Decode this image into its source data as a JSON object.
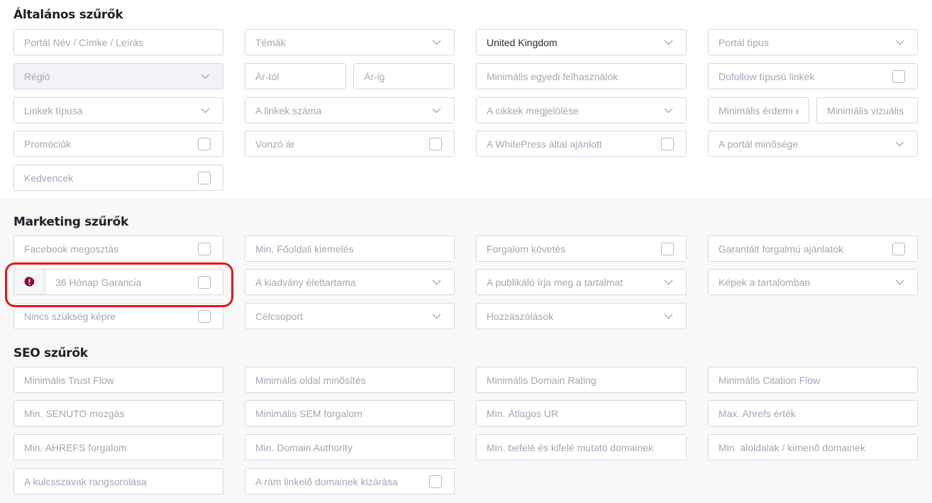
{
  "sections": {
    "general": {
      "title": "Általános szűrők",
      "fields": {
        "portal_search": {
          "placeholder": "Portál Név / Címke / Leírás",
          "type": "text"
        },
        "topics": {
          "label": "Témák",
          "type": "select"
        },
        "country": {
          "value": "United Kingdom",
          "type": "select"
        },
        "portal_type": {
          "label": "Portál típus",
          "type": "select"
        },
        "region": {
          "label": "Régió",
          "type": "select",
          "disabled": true
        },
        "price_from": {
          "placeholder": "Ár-tól",
          "type": "text"
        },
        "price_to": {
          "placeholder": "Ár-ig",
          "type": "text"
        },
        "min_unique_users": {
          "placeholder": "Minimális egyedi felhasználók",
          "type": "text"
        },
        "dofollow_links": {
          "label": "Dofollow típusú linkek",
          "type": "checkbox",
          "checked": false
        },
        "link_type": {
          "label": "Linkek típusa",
          "type": "select"
        },
        "link_count": {
          "label": "A linkek száma",
          "type": "select"
        },
        "article_marking": {
          "label": "A cikkek megjelölése",
          "type": "select"
        },
        "min_substantive": {
          "placeholder": "Minimális érdemi é",
          "type": "text"
        },
        "min_visual": {
          "placeholder": "Minimális vizuális é",
          "type": "text"
        },
        "promotions": {
          "label": "Promóciók",
          "type": "checkbox",
          "checked": false
        },
        "attractive_price": {
          "label": "Vonzó ár",
          "type": "checkbox",
          "checked": false
        },
        "whitepress_recommended": {
          "label": "A WhitePress által ajánlott",
          "type": "checkbox",
          "checked": false
        },
        "portal_quality": {
          "label": "A portál minősége",
          "type": "select"
        },
        "favorites": {
          "label": "Kedvencek",
          "type": "checkbox",
          "checked": false
        }
      }
    },
    "marketing": {
      "title": "Marketing szűrők",
      "fields": {
        "facebook_share": {
          "label": "Facebook megosztás",
          "type": "checkbox",
          "checked": false
        },
        "min_homepage_feature": {
          "placeholder": "Min. Főoldali kiemelés",
          "type": "text"
        },
        "traffic_tracking": {
          "label": "Forgalom követés",
          "type": "checkbox",
          "checked": false
        },
        "guaranteed_traffic": {
          "label": "Garantált forgalmú ajánlatok",
          "type": "checkbox",
          "checked": false
        },
        "guarantee_36": {
          "label": "36 Hónap Garancia",
          "type": "checkbox",
          "checked": false,
          "icon": "badge-exclamation-icon",
          "highlighted": true
        },
        "publication_lifetime": {
          "label": "A kiadvány élettartama",
          "type": "select"
        },
        "publisher_writes": {
          "label": "A publikáló írja meg a tartalmat",
          "type": "select"
        },
        "images_in_content": {
          "label": "Képek a tartalomban",
          "type": "select"
        },
        "no_image_needed": {
          "label": "Nincs szükség képre",
          "type": "checkbox",
          "checked": false
        },
        "target_group": {
          "label": "Célcsoport",
          "type": "select"
        },
        "comments": {
          "label": "Hozzászólások",
          "type": "select"
        }
      }
    },
    "seo": {
      "title": "SEO szűrők",
      "fields": {
        "min_trust_flow": {
          "placeholder": "Minimális Trust Flow",
          "type": "text"
        },
        "min_page_rating": {
          "placeholder": "Minimális oldal minősítés",
          "type": "text"
        },
        "min_domain_rating": {
          "placeholder": "Minimális Domain Rating",
          "type": "text"
        },
        "min_citation_flow": {
          "placeholder": "Minimális Citation Flow",
          "type": "text"
        },
        "min_senuto": {
          "placeholder": "Min. SENUTO mozgás",
          "type": "text"
        },
        "min_sem_traffic": {
          "placeholder": "Minimális SEM forgalom",
          "type": "text"
        },
        "min_avg_ur": {
          "placeholder": "Min. Átlagos UR",
          "type": "text"
        },
        "max_ahrefs": {
          "placeholder": "Max. Ahrefs érték",
          "type": "text"
        },
        "min_ahrefs_traffic": {
          "placeholder": "Min. AHREFS forgalom",
          "type": "text"
        },
        "min_domain_authority": {
          "placeholder": "Min. Domain Authority",
          "type": "text"
        },
        "min_in_out_domains": {
          "placeholder": "Min. befelé és kifelé mutató domainek",
          "type": "text"
        },
        "min_subpages_outgoing": {
          "placeholder": "Min. aloldalak / kimenő domainek",
          "type": "text"
        },
        "keyword_ranking": {
          "placeholder": "A kulcsszavak rangsorolása",
          "type": "text"
        },
        "exclude_linking_domains": {
          "label": "A rám linkelő domainek kizárása",
          "type": "checkbox",
          "checked": false
        }
      }
    }
  },
  "colors": {
    "highlight_border": "#e8141c",
    "badge_icon": "#8b0a2e",
    "placeholder_text": "#a3a7b7",
    "section_gray_bg": "#f8f8f8"
  }
}
